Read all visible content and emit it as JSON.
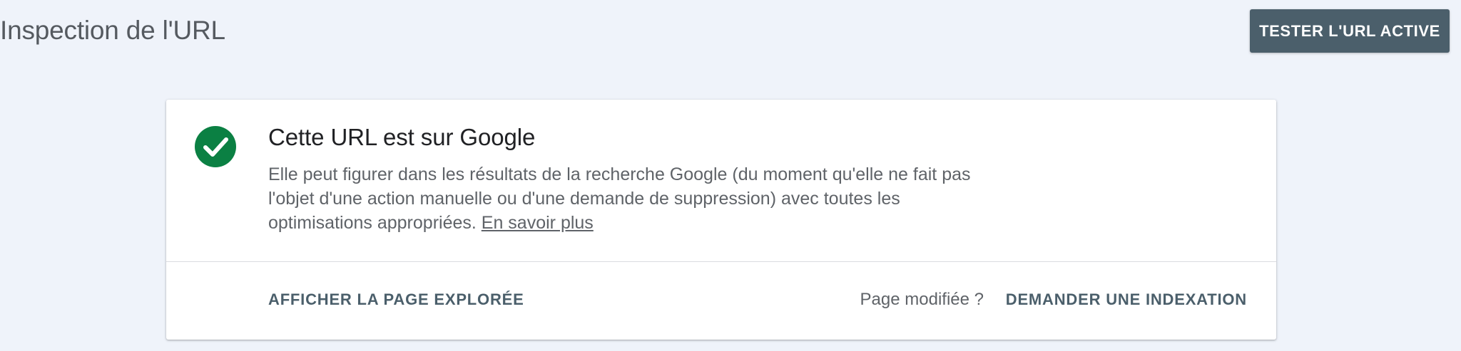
{
  "header": {
    "title": "Inspection de l'URL",
    "test_live_label": "TESTER L'URL ACTIVE"
  },
  "status_card": {
    "icon": "check-circle-icon",
    "icon_color": "#0b8043",
    "title": "Cette URL est sur Google",
    "description": "Elle peut figurer dans les résultats de la recherche Google (du moment qu'elle ne fait pas l'objet d'une action manuelle ou d'une demande de suppression) avec toutes les optimisations appropriées.",
    "learn_more_label": "En savoir plus",
    "view_crawled_label": "AFFICHER LA PAGE EXPLORÉE",
    "page_changed_label": "Page modifiée ?",
    "request_indexing_label": "DEMANDER UNE INDEXATION"
  },
  "colors": {
    "background": "#eff3fa",
    "primary_button": "#4b5f6b",
    "success": "#0b8043"
  }
}
